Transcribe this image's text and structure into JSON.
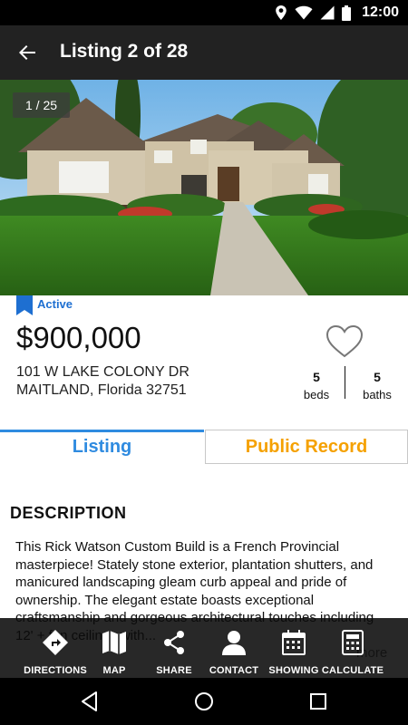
{
  "status_bar": {
    "time": "12:00"
  },
  "app_bar": {
    "title": "Listing 2 of 28"
  },
  "photo": {
    "counter": "1 / 25"
  },
  "listing": {
    "status": "Active",
    "price": "$900,000",
    "address_line1": "101 W LAKE COLONY DR",
    "address_line2": "MAITLAND, Florida 32751",
    "beds_value": "5",
    "beds_label": "beds",
    "baths_value": "5",
    "baths_label": "baths"
  },
  "tabs": {
    "listing": "Listing",
    "public_record": "Public Record"
  },
  "description": {
    "title": "DESCRIPTION",
    "text": "This Rick Watson Custom Build is a French Provincial masterpiece! Stately stone exterior, plantation shutters, and manicured landscaping gleam curb appeal and pride of ownership. The elegant estate boasts exceptional craftsmanship and gorgeous architectural touches including 12' + fan ceilings with...",
    "more": "more"
  },
  "actions": [
    {
      "label": "DIRECTIONS",
      "icon": "directions-icon"
    },
    {
      "label": "MAP",
      "icon": "map-icon"
    },
    {
      "label": "SHARE",
      "icon": "share-icon"
    },
    {
      "label": "CONTACT",
      "icon": "contact-icon"
    },
    {
      "label": "SHOWING",
      "icon": "calendar-icon"
    },
    {
      "label": "CALCULATE",
      "icon": "calculator-icon"
    }
  ],
  "colors": {
    "accent_blue": "#2f8be0",
    "accent_orange": "#f5a100",
    "app_bar": "#222222"
  }
}
